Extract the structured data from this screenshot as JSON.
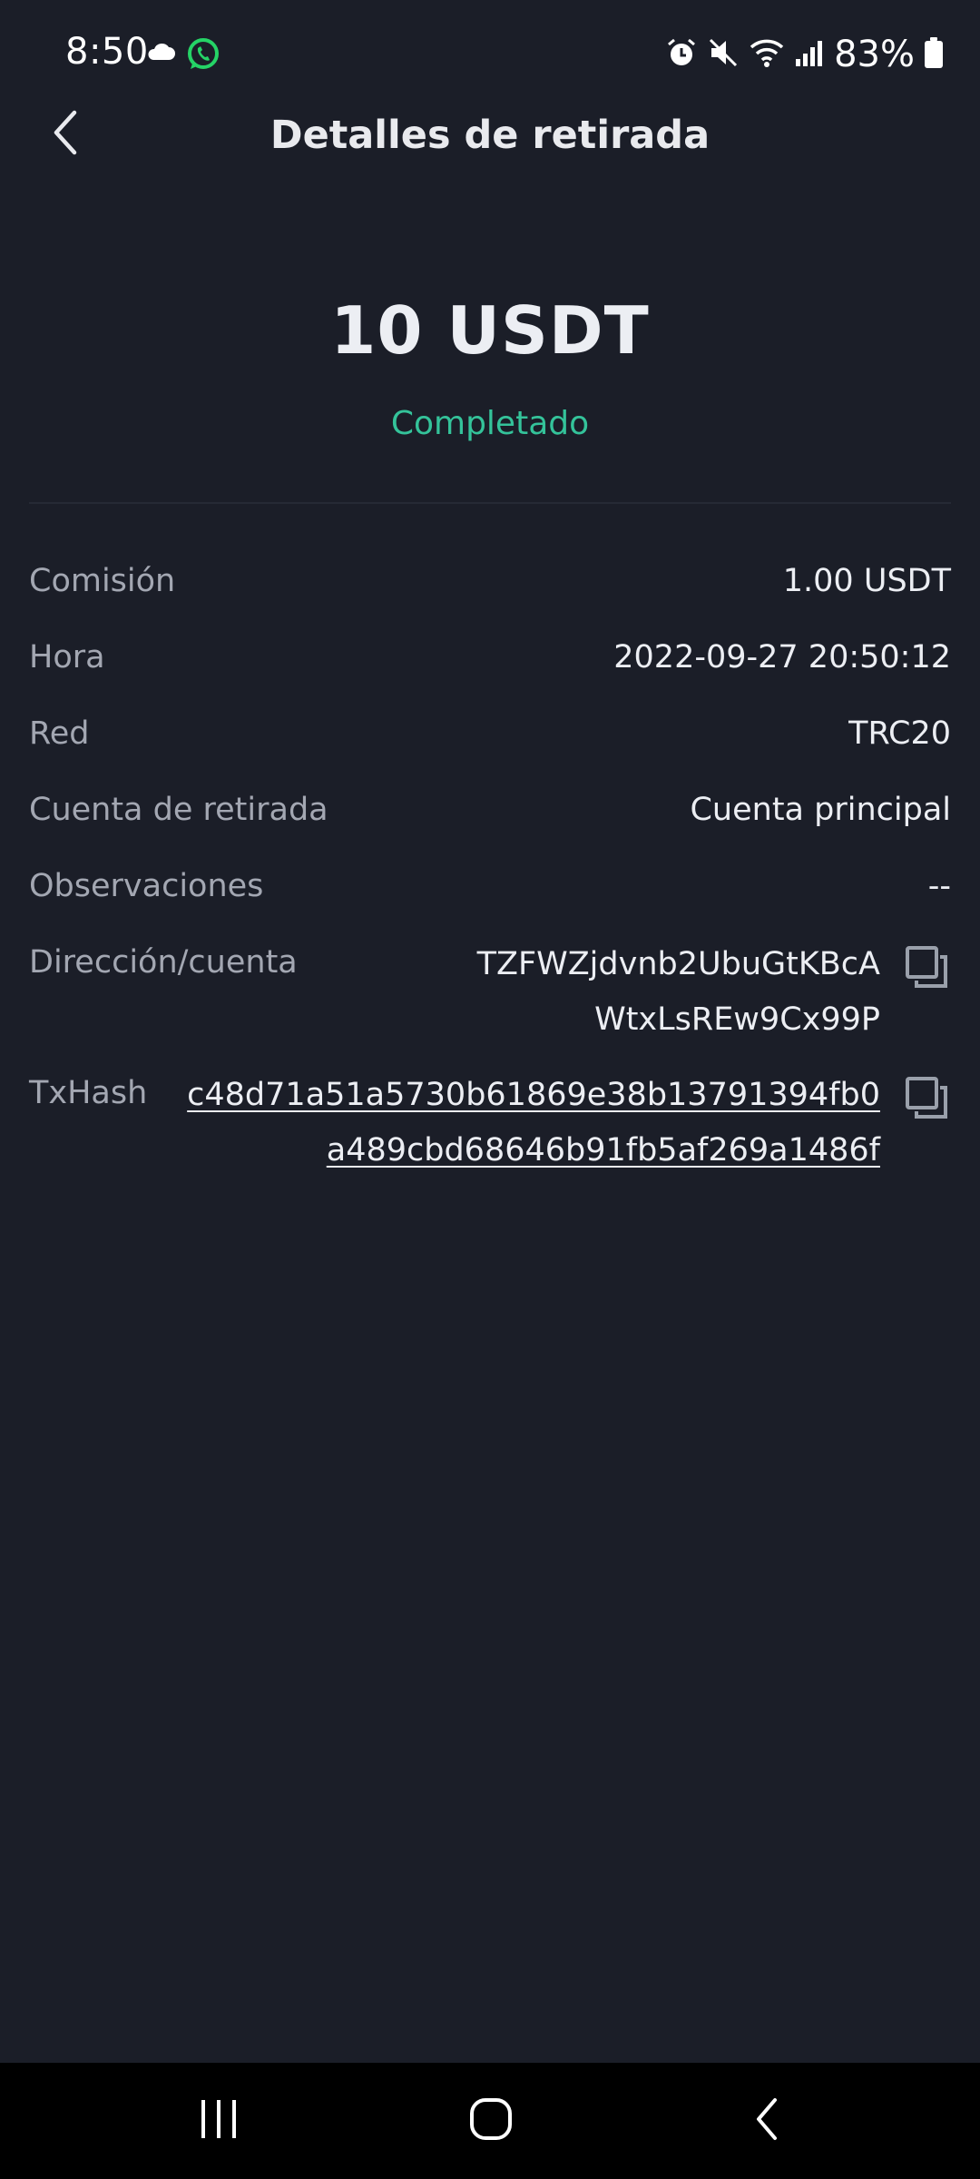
{
  "status_bar": {
    "time": "8:50",
    "battery_percent": "83%",
    "icons": [
      "cloud-icon",
      "whatsapp-icon",
      "alarm-icon",
      "mute-icon",
      "wifi-icon",
      "signal-icon",
      "battery-icon"
    ]
  },
  "header": {
    "title": "Detalles de retirada",
    "back_icon": "chevron-left-icon"
  },
  "summary": {
    "amount": "10 USDT",
    "status": "Completado",
    "status_color": "#34c39a"
  },
  "details": {
    "fee": {
      "label": "Comisión",
      "value": "1.00 USDT"
    },
    "time": {
      "label": "Hora",
      "value": "2022-09-27 20:50:12"
    },
    "network": {
      "label": "Red",
      "value": "TRC20"
    },
    "account": {
      "label": "Cuenta de retirada",
      "value": "Cuenta principal"
    },
    "remarks": {
      "label": "Observaciones",
      "value": "--"
    },
    "address": {
      "label": "Dirección/cuenta",
      "line1": "TZFWZjdvnb2UbuGtKBcA",
      "line2": "WtxLsREw9Cx99P"
    },
    "txhash": {
      "label": "TxHash",
      "line1": "c48d71a51a5730b61869e38b13791394fb0",
      "line2": "a489cbd68646b91fb5af269a1486f"
    }
  },
  "nav_bar": {
    "buttons": [
      "recent-apps-icon",
      "home-icon",
      "back-icon"
    ]
  },
  "colors": {
    "background": "#1b1e28",
    "text_primary": "#eceef3",
    "text_secondary": "#a3a7b2",
    "accent_success": "#34c39a",
    "nav_background": "#000000"
  }
}
